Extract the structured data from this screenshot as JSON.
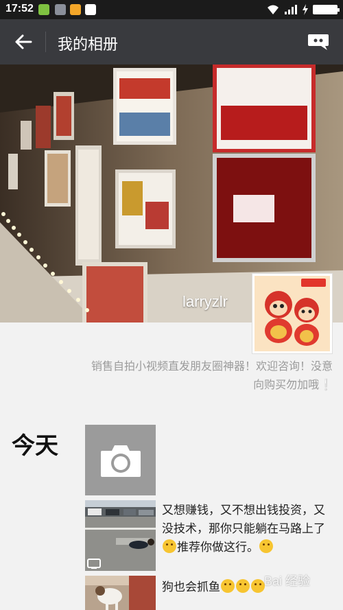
{
  "status_bar": {
    "time": "17:52",
    "battery_level": 1.0,
    "icons": [
      "wifi-icon",
      "signal-icon",
      "charging-icon",
      "battery-icon"
    ]
  },
  "app_bar": {
    "title": "我的相册",
    "back_icon": "back-arrow-icon",
    "message_icon": "message-icon"
  },
  "profile": {
    "username": "larryzlr",
    "signature": "销售自拍小视频直发朋友圈神器！欢迎咨询！没意向购买勿加哦❕"
  },
  "feed": {
    "day_label": "今天",
    "camera_icon": "camera-icon",
    "posts": [
      {
        "text": "又想赚钱，又不想出钱投资，又没技术，那你只能躺在马路上了",
        "text_tail": "推荐你做这行。",
        "thumb_icon": "video-icon"
      },
      {
        "text": "狗也会抓鱼"
      }
    ]
  },
  "watermark": {
    "text": "Bai 经验"
  },
  "colors": {
    "status_bar": "#1b1b1b",
    "app_bar": "#393a3e",
    "background": "#f2f2f2",
    "signature": "#9b9b9b"
  }
}
